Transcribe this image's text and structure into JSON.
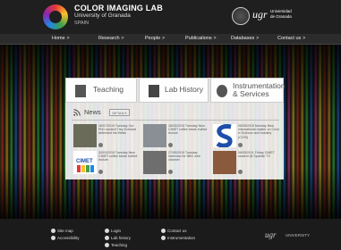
{
  "header": {
    "title": "COLOR IMAGING LAB",
    "subtitle": "University of Granada",
    "country": "SPAIN",
    "ugr_logo_text": "ugr",
    "ugr_name": "Universidad de Granada"
  },
  "nav": {
    "items": [
      {
        "label": "Home"
      },
      {
        "label": "Research"
      },
      {
        "label": "People"
      },
      {
        "label": "Publications"
      },
      {
        "label": "Databases"
      },
      {
        "label": "Contact us"
      }
    ],
    "chevron": ">"
  },
  "tiles": [
    {
      "label": "Teaching",
      "icon": "book-icon"
    },
    {
      "label": "Lab History",
      "icon": "history-icon"
    },
    {
      "label": "Instrumentation & Services",
      "icon": "gear-icon"
    }
  ],
  "news": {
    "title": "News",
    "button_label": "DETAILS",
    "items": [
      {
        "date": "28/07/2015 Tuesday",
        "text": "Our PhD student Trey Eckhard defended his thesis",
        "thumb_color": "#6b6b5a"
      },
      {
        "date": "28/05/2015 Tuesday",
        "text": "New CIMET coffee break invited lecture",
        "thumb_color": "#8a8f96"
      },
      {
        "date": "05/05/2015 Monday",
        "text": "New international master on Color in Science and Industry (COSI)",
        "thumb_color": "#1e4fa8"
      },
      {
        "date": "30/03/2015 Tuesday",
        "text": "New CIMET coffee break invited lecture",
        "thumb_color": "#c53a2f"
      },
      {
        "date": "27/05/2015 Tuesday",
        "text": "Interview for NBC web channel",
        "thumb_color": "#6e6e6e"
      },
      {
        "date": "06/05/2011 Friday",
        "text": "CIMET student @ Spanish TV",
        "thumb_color": "#8b5a3c"
      }
    ]
  },
  "footer": {
    "col1": [
      "Site map",
      "Accessibility"
    ],
    "col2": [
      "Login",
      "Lab history",
      "Teaching"
    ],
    "col3": [
      "Contact us",
      "Instrumentation"
    ],
    "ugr_logo_text": "ugr",
    "university_label": "UNIVERSITY"
  }
}
